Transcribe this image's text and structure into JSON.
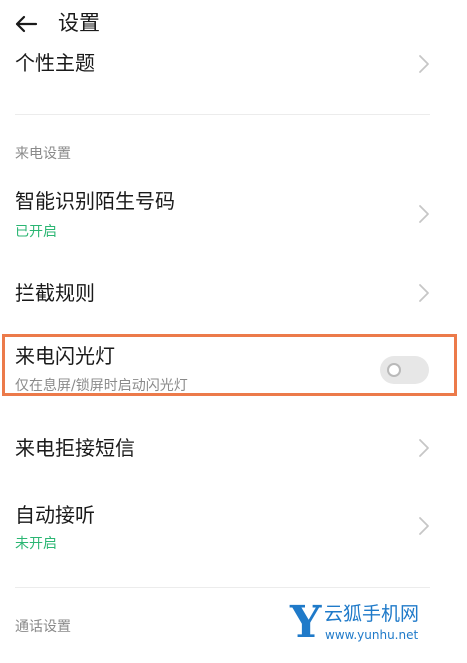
{
  "header": {
    "back_icon": "arrow-left-icon",
    "title": "设置"
  },
  "list": {
    "theme": {
      "title": "个性主题"
    },
    "section_incoming": "来电设置",
    "smart_identify": {
      "title": "智能识别陌生号码",
      "status": "已开启"
    },
    "block_rules": {
      "title": "拦截规则"
    },
    "flash_light": {
      "title": "来电闪光灯",
      "subtitle": "仅在息屏/锁屏时启动闪光灯",
      "enabled": false
    },
    "reject_sms": {
      "title": "来电拒接短信"
    },
    "auto_answer": {
      "title": "自动接听",
      "status": "未开启"
    },
    "section_call": "通话设置"
  },
  "watermark": {
    "logo_letter": "Y",
    "name": "云狐手机网",
    "url": "www.yunhu.net"
  },
  "colors": {
    "status_green": "#2bb673",
    "highlight_orange": "#ec7a4a",
    "watermark_blue": "#1f7ac9"
  }
}
